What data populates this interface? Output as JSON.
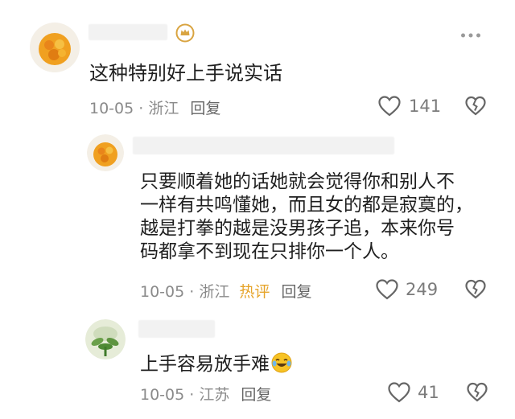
{
  "comments": [
    {
      "text": "这种特别好上手说实话",
      "date": "10-05",
      "location": "浙江",
      "reply_label": "回复",
      "likes": "141",
      "badge_icon": "crown-badge-icon"
    },
    {
      "text_lines": [
        "只要顺着她的话她就会觉得你和别人不",
        "一样有共鸣懂她，而且女的都是寂寞的，",
        "越是打拳的越是没男孩子追，本来你号",
        "码都拿不到现在只排你一个人。"
      ],
      "date": "10-05",
      "location": "浙江",
      "hot_label": "热评",
      "reply_label": "回复",
      "likes": "249"
    },
    {
      "text": "上手容易放手难",
      "emoji": "laughing-crying-emoji",
      "date": "10-05",
      "location": "江苏",
      "reply_label": "回复",
      "likes": "41"
    }
  ],
  "separator": "·",
  "colors": {
    "meta_gray": "#8a8a8a",
    "hot_label": "#e6a42a",
    "badge_gold": "#d9a441"
  }
}
